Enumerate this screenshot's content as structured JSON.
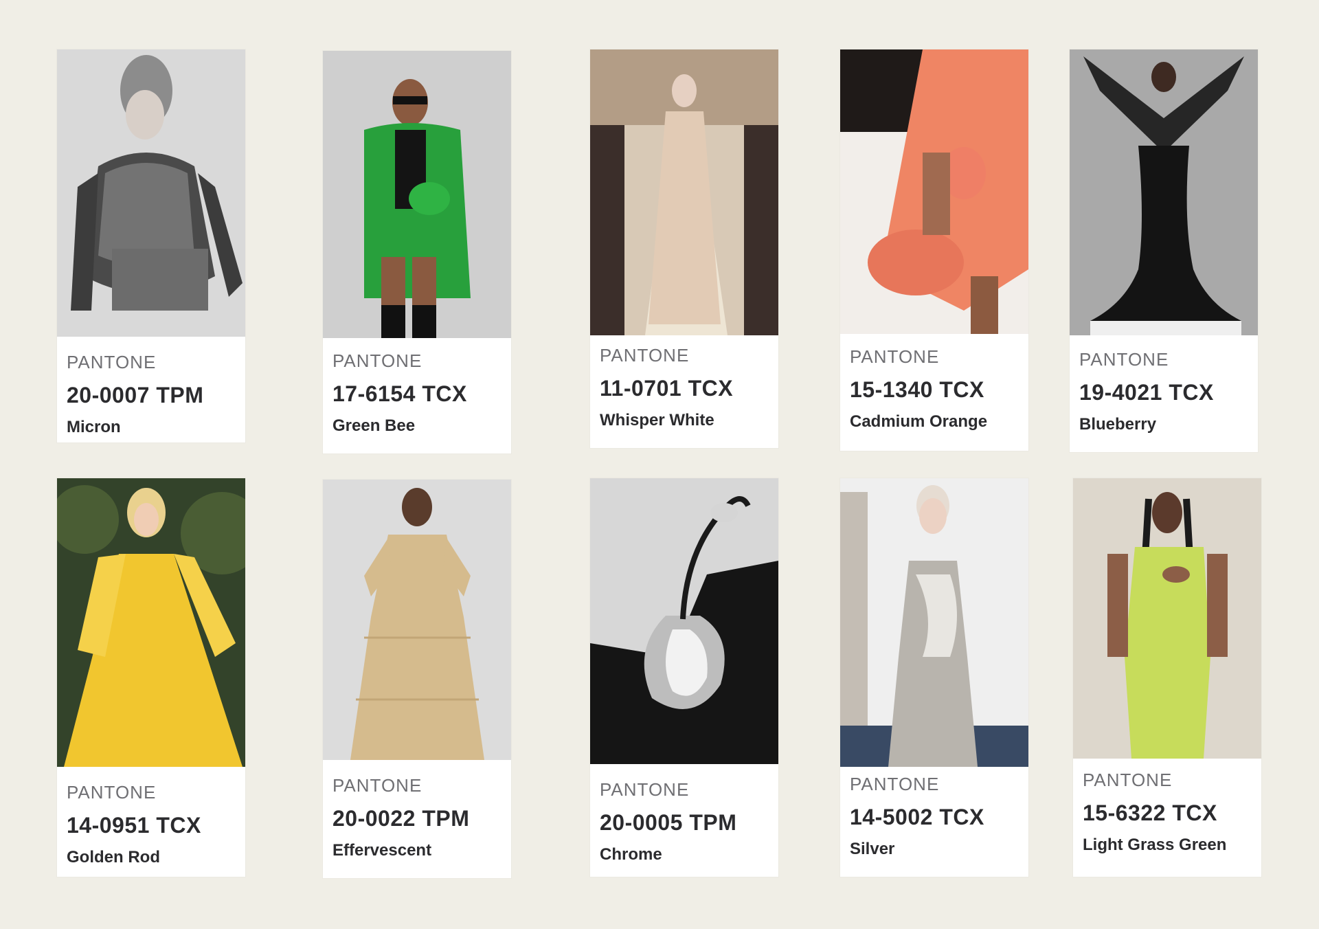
{
  "swatches": [
    {
      "brand": "PANTONE",
      "code": "20-0007 TPM",
      "name": "Micron"
    },
    {
      "brand": "PANTONE",
      "code": "17-6154 TCX",
      "name": "Green Bee"
    },
    {
      "brand": "PANTONE",
      "code": "11-0701 TCX",
      "name": "Whisper White"
    },
    {
      "brand": "PANTONE",
      "code": "15-1340 TCX",
      "name": "Cadmium Orange"
    },
    {
      "brand": "PANTONE",
      "code": "19-4021 TCX",
      "name": "Blueberry"
    },
    {
      "brand": "PANTONE",
      "code": "14-0951 TCX",
      "name": "Golden Rod"
    },
    {
      "brand": "PANTONE",
      "code": "20-0022 TPM",
      "name": "Effervescent"
    },
    {
      "brand": "PANTONE",
      "code": "20-0005 TPM",
      "name": "Chrome"
    },
    {
      "brand": "PANTONE",
      "code": "14-5002 TCX",
      "name": "Silver"
    },
    {
      "brand": "PANTONE",
      "code": "15-6322 TCX",
      "name": "Light Grass Green"
    }
  ],
  "colors": {
    "page_background": "#f0eee6",
    "card_background": "#ffffff",
    "label_gray": "#6f6f73",
    "text_dark": "#2b2b2e"
  }
}
